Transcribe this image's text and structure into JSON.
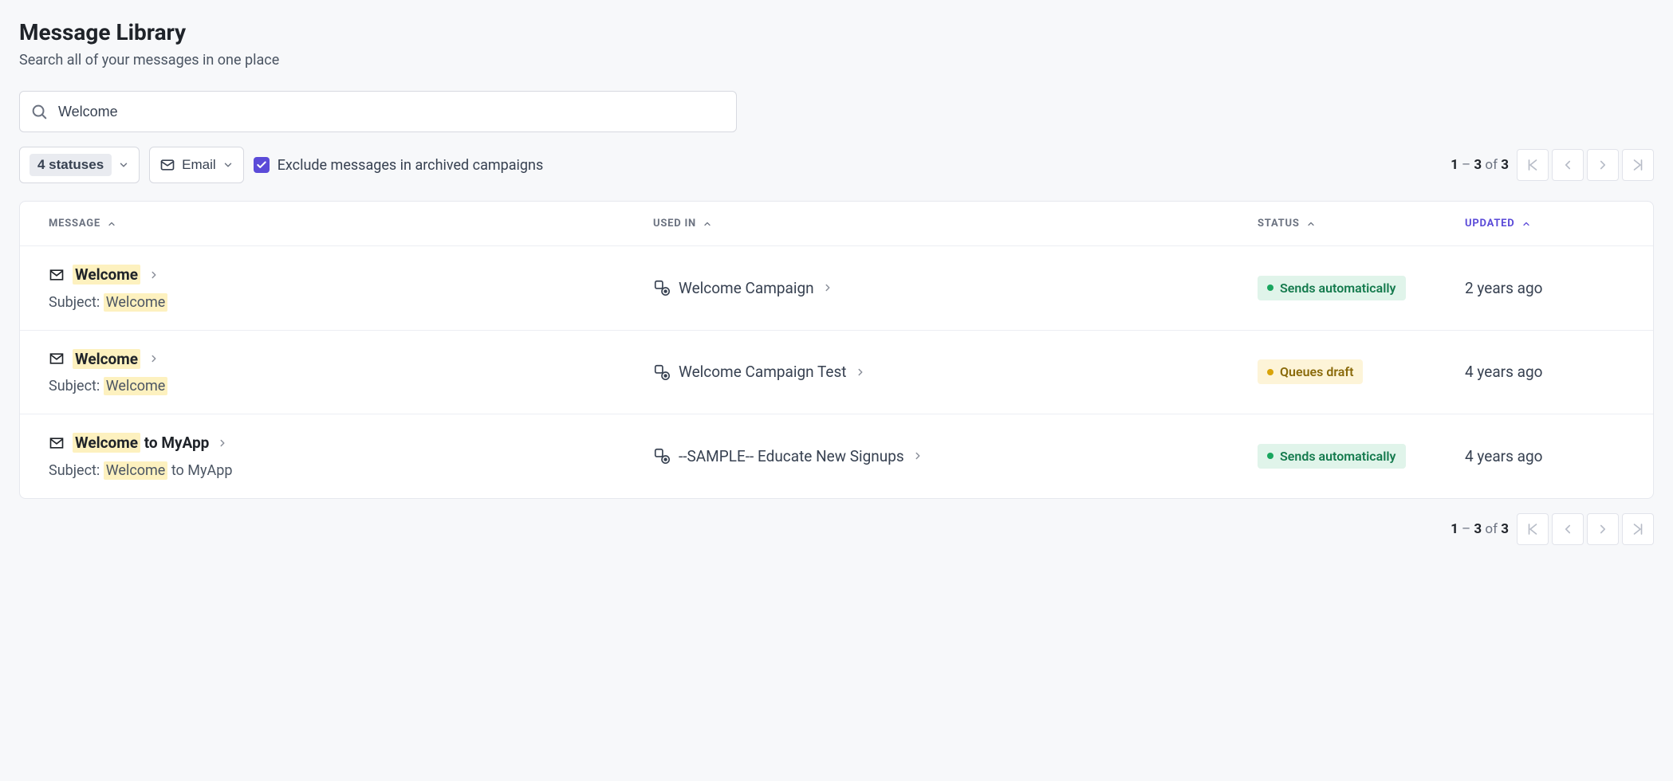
{
  "header": {
    "title": "Message Library",
    "subtitle": "Search all of your messages in one place"
  },
  "search": {
    "value": "Welcome",
    "placeholder": ""
  },
  "filters": {
    "status_label": "4 statuses",
    "channel_label": "Email",
    "exclude_archived_label": "Exclude messages in archived campaigns",
    "exclude_archived_checked": true
  },
  "pagination": {
    "range_start": "1",
    "range_end": "3",
    "of_text": "of",
    "total": "3"
  },
  "columns": {
    "message": "MESSAGE",
    "used_in": "USED IN",
    "status": "STATUS",
    "updated": "UPDATED"
  },
  "subject_prefix": "Subject:",
  "highlight_term": "Welcome",
  "rows": [
    {
      "title_pre": "",
      "title_hl": "Welcome",
      "title_post": "",
      "subject_pre": "",
      "subject_hl": "Welcome",
      "subject_post": "",
      "used_in": "Welcome Campaign",
      "status_text": "Sends automatically",
      "status_kind": "green",
      "updated": "2 years ago"
    },
    {
      "title_pre": "",
      "title_hl": "Welcome",
      "title_post": "",
      "subject_pre": "",
      "subject_hl": "Welcome",
      "subject_post": "",
      "used_in": "Welcome Campaign Test",
      "status_text": "Queues draft",
      "status_kind": "yellow",
      "updated": "4 years ago"
    },
    {
      "title_pre": "",
      "title_hl": "Welcome",
      "title_post": " to MyApp",
      "subject_pre": "",
      "subject_hl": "Welcome",
      "subject_post": " to MyApp",
      "used_in": "--SAMPLE-- Educate New Signups",
      "status_text": "Sends automatically",
      "status_kind": "green",
      "updated": "4 years ago"
    }
  ]
}
